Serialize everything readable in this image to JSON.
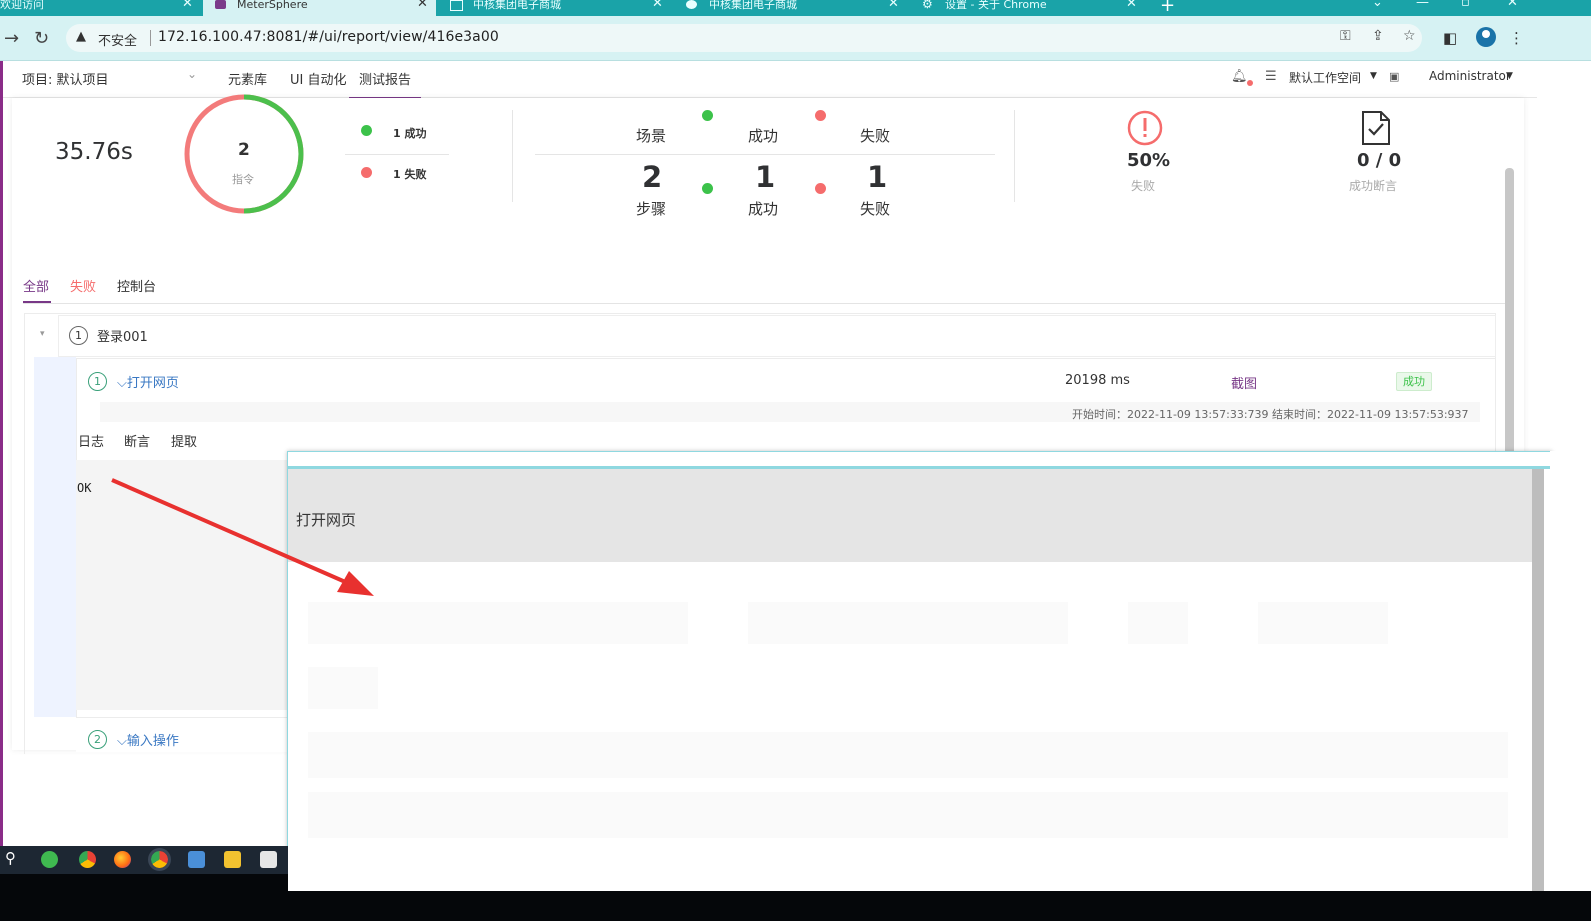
{
  "browser": {
    "tabs": [
      {
        "title": "欢迎访问"
      },
      {
        "title": "MeterSphere"
      },
      {
        "title": "中核集团电子商城"
      },
      {
        "title": "中核集团电子商城"
      },
      {
        "title": "设置 - 关于 Chrome"
      }
    ],
    "insecure_label": "不安全",
    "url": "172.16.100.47:8081/#/ui/report/view/416e3a00"
  },
  "header": {
    "project_label": "项目: 默认项目",
    "menu": [
      "元素库",
      "UI 自动化",
      "测试报告"
    ],
    "workspace": "默认工作空间",
    "user": "Administrator"
  },
  "summary": {
    "duration": "35.76s",
    "commands": {
      "count": "2",
      "label": "指令",
      "success_legend": "1 成功",
      "fail_legend": "1 失败"
    },
    "scenario": {
      "success_label": "成功",
      "fail_label": "失败",
      "label": "场景"
    },
    "steps": {
      "count": "2",
      "label": "步骤",
      "success": "1",
      "success_label": "成功",
      "fail": "1",
      "fail_label": "失败"
    },
    "fail_rate": {
      "value": "50%",
      "label": "失败"
    },
    "assertions": {
      "value": "0 / 0",
      "label": "成功断言"
    }
  },
  "tabs": {
    "all": "全部",
    "fail": "失败",
    "console": "控制台"
  },
  "tree": {
    "root": {
      "index": "1",
      "name": "登录001"
    },
    "step1": {
      "index": "1",
      "name": "⌵打开网页",
      "duration": "20198 ms",
      "screenshot": "截图",
      "status": "成功",
      "times": "开始时间：2022-11-09 13:57:33:739 结束时间：2022-11-09 13:57:53:937"
    },
    "subtabs": [
      "日志",
      "断言",
      "提取"
    ],
    "log": "OK",
    "step2": {
      "index": "2",
      "name": "⌵输入操作"
    }
  },
  "overlay": {
    "title": "打开网页"
  },
  "colors": {
    "accent": "#783887",
    "success": "#3cc24a",
    "fail": "#f56c6c",
    "tabbar": "#1aa3a8"
  }
}
